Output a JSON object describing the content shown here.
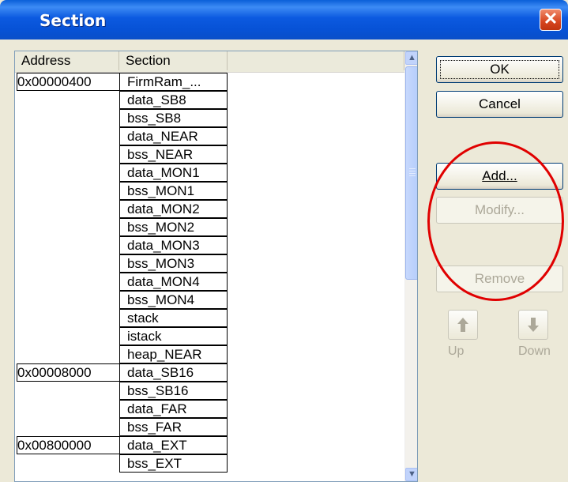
{
  "window": {
    "title": "Section",
    "close_glyph": "✕"
  },
  "list": {
    "columns": [
      "Address",
      "Section"
    ],
    "rows": [
      {
        "address": "0x00000400",
        "section": "FirmRam_..."
      },
      {
        "address": "",
        "section": "data_SB8"
      },
      {
        "address": "",
        "section": "bss_SB8"
      },
      {
        "address": "",
        "section": "data_NEAR"
      },
      {
        "address": "",
        "section": "bss_NEAR"
      },
      {
        "address": "",
        "section": "data_MON1"
      },
      {
        "address": "",
        "section": "bss_MON1"
      },
      {
        "address": "",
        "section": "data_MON2"
      },
      {
        "address": "",
        "section": "bss_MON2"
      },
      {
        "address": "",
        "section": "data_MON3"
      },
      {
        "address": "",
        "section": "bss_MON3"
      },
      {
        "address": "",
        "section": "data_MON4"
      },
      {
        "address": "",
        "section": "bss_MON4"
      },
      {
        "address": "",
        "section": "stack"
      },
      {
        "address": "",
        "section": "istack"
      },
      {
        "address": "",
        "section": "heap_NEAR"
      },
      {
        "address": "0x00008000",
        "section": "data_SB16"
      },
      {
        "address": "",
        "section": "bss_SB16"
      },
      {
        "address": "",
        "section": "data_FAR"
      },
      {
        "address": "",
        "section": "bss_FAR"
      },
      {
        "address": "0x00800000",
        "section": "data_EXT"
      },
      {
        "address": "",
        "section": "bss_EXT"
      }
    ],
    "scroll_up_glyph": "▲",
    "scroll_down_glyph": "▼"
  },
  "buttons": {
    "ok": "OK",
    "cancel": "Cancel",
    "add": "Add...",
    "modify": "Modify...",
    "remove": "Remove",
    "up": "Up",
    "down": "Down"
  },
  "icons": {
    "up": "up-arrow-icon",
    "down": "down-arrow-icon",
    "close": "close-icon"
  },
  "colors": {
    "title_bar": "#0a5fd8",
    "annotation_ring": "#e00000",
    "dialog_bg": "#ece9d8"
  }
}
